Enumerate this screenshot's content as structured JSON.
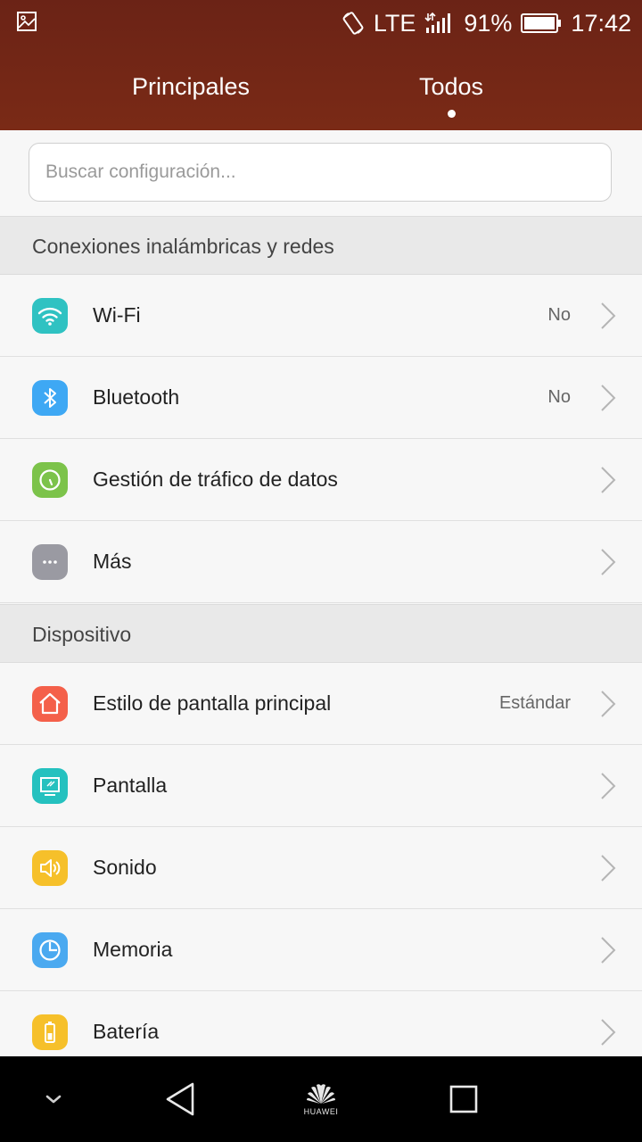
{
  "status_bar": {
    "network": "LTE",
    "battery": "91%",
    "time": "17:42",
    "icons": [
      "image-notification-icon",
      "rotation-lock-icon",
      "data-arrows-icon",
      "signal-icon",
      "battery-icon"
    ]
  },
  "tabs": [
    {
      "label": "Principales",
      "selected": false
    },
    {
      "label": "Todos",
      "selected": true
    }
  ],
  "search": {
    "placeholder": "Buscar configuración..."
  },
  "sections": [
    {
      "title": "Conexiones inalámbricas y redes",
      "items": [
        {
          "label": "Wi-Fi",
          "value": "No",
          "icon": "wifi-icon",
          "color": "#2fc2c2"
        },
        {
          "label": "Bluetooth",
          "value": "No",
          "icon": "bluetooth-icon",
          "color": "#3ea8f4"
        },
        {
          "label": "Gestión de tráfico de datos",
          "value": "",
          "icon": "data-traffic-icon",
          "color": "#7cc34a"
        },
        {
          "label": "Más",
          "value": "",
          "icon": "more-icon",
          "color": "#9a9aa2"
        }
      ]
    },
    {
      "title": "Dispositivo",
      "items": [
        {
          "label": "Estilo de pantalla principal",
          "value": "Estándar",
          "icon": "home-icon",
          "color": "#f4604a"
        },
        {
          "label": "Pantalla",
          "value": "",
          "icon": "display-icon",
          "color": "#25c1bf"
        },
        {
          "label": "Sonido",
          "value": "",
          "icon": "sound-icon",
          "color": "#f6c02a"
        },
        {
          "label": "Memoria",
          "value": "",
          "icon": "memory-icon",
          "color": "#4aa9f0"
        },
        {
          "label": "Batería",
          "value": "",
          "icon": "battery-setting-icon",
          "color": "#f6c02a"
        }
      ]
    }
  ],
  "nav_bar": {
    "brand": "HUAWEI",
    "icons": [
      "hide-nav-icon",
      "back-icon",
      "home-logo-icon",
      "recents-icon"
    ]
  }
}
